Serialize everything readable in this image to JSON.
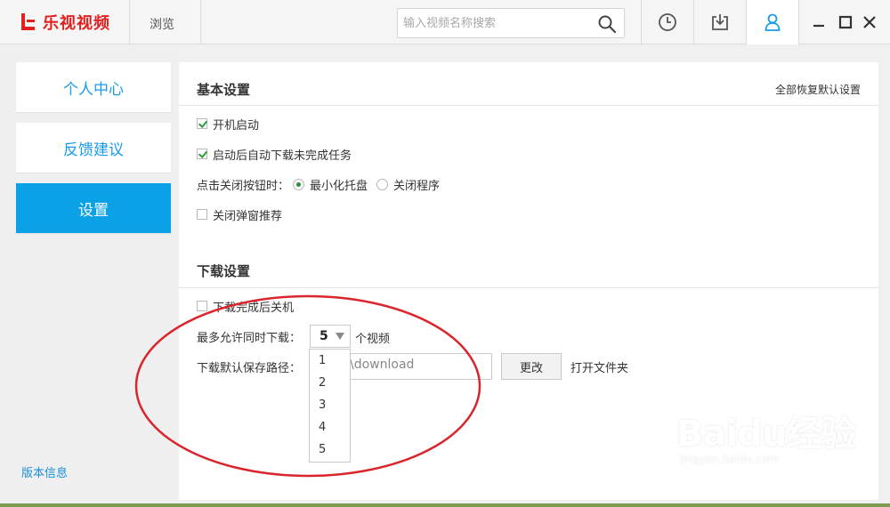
{
  "app": {
    "logo_text": "乐视视频"
  },
  "topnav": {
    "browse_label": "浏览"
  },
  "search": {
    "placeholder": "输入视频名称搜索"
  },
  "toolbar": {
    "history_icon": "clock-icon",
    "download_icon": "download-icon",
    "user_icon": "user-icon"
  },
  "sidebar": {
    "items": [
      {
        "label": "个人中心"
      },
      {
        "label": "反馈建议"
      },
      {
        "label": "设置"
      }
    ],
    "version_link": "版本信息"
  },
  "basic_settings": {
    "title": "基本设置",
    "restore_defaults": "全部恢复默认设置",
    "startup_label": "开机启动",
    "auto_download_label": "启动后自动下载未完成任务",
    "close_button_label": "点击关闭按钮时：",
    "minimize_tray_label": "最小化托盘",
    "close_program_label": "关闭程序",
    "close_popup_label": "关闭弹窗推荐"
  },
  "download_settings": {
    "title": "下载设置",
    "shutdown_label": "下载完成后关机",
    "max_concurrent_label": "最多允许同时下载：",
    "max_concurrent_value": "5",
    "unit_label": "个视频",
    "options": [
      "1",
      "2",
      "3",
      "4",
      "5"
    ],
    "save_path_label": "下载默认保存路径：",
    "save_path_value": "\\download",
    "change_button": "更改",
    "open_folder": "打开文件夹"
  },
  "watermark": {
    "brand": "Baidu经验",
    "url": "jingyan.baidu.com"
  },
  "colors": {
    "brand_red": "#e1201f",
    "accent_blue": "#0aa1e6",
    "annotation_red": "#d9252b"
  }
}
